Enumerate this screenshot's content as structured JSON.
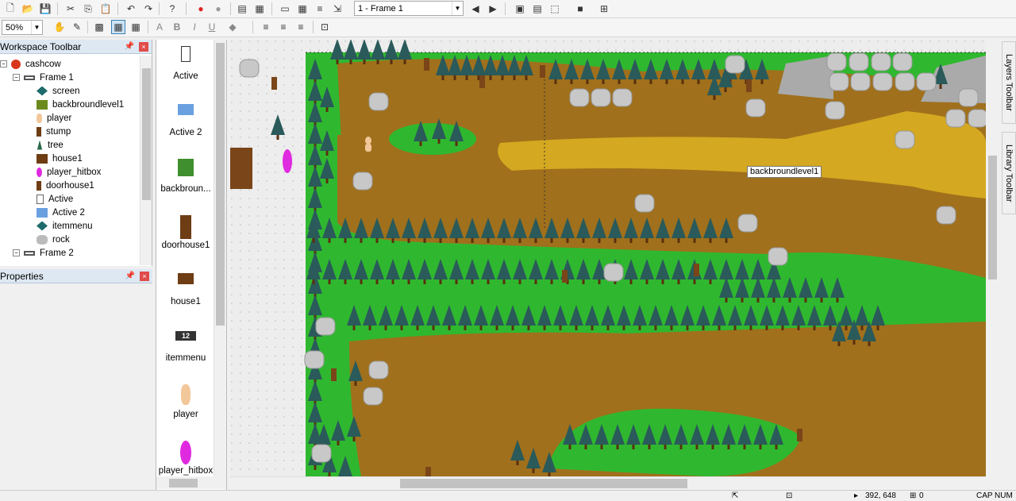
{
  "toolbar": {
    "frame_select": "1 - Frame 1",
    "zoom": "50%",
    "bold": "B",
    "italic": "I",
    "underline": "U"
  },
  "workspace": {
    "title": "Workspace Toolbar",
    "items": [
      {
        "label": "cashcow",
        "icon": "app-icon"
      },
      {
        "label": "Frame 1",
        "icon": "frame-icon"
      },
      {
        "label": "screen",
        "icon": "diamond-icon"
      },
      {
        "label": "backbroundlevel1",
        "icon": "backdrop-icon"
      },
      {
        "label": "player",
        "icon": "player-icon"
      },
      {
        "label": "stump",
        "icon": "stump-icon"
      },
      {
        "label": "tree",
        "icon": "tree-icon"
      },
      {
        "label": "house1",
        "icon": "house-icon"
      },
      {
        "label": "player_hitbox",
        "icon": "hitbox-icon"
      },
      {
        "label": "doorhouse1",
        "icon": "door-icon"
      },
      {
        "label": "Active",
        "icon": "active-icon"
      },
      {
        "label": "Active 2",
        "icon": "active2-icon"
      },
      {
        "label": "itemmenu",
        "icon": "diamond-icon"
      },
      {
        "label": "rock",
        "icon": "rock-icon"
      },
      {
        "label": "Frame 2",
        "icon": "frame-icon"
      }
    ]
  },
  "properties": {
    "title": "Properties"
  },
  "library": {
    "items": [
      {
        "label": "Active"
      },
      {
        "label": "Active 2"
      },
      {
        "label": "backbroun..."
      },
      {
        "label": "doorhouse1"
      },
      {
        "label": "house1"
      },
      {
        "label": "itemmenu"
      },
      {
        "label": "player"
      },
      {
        "label": "player_hitbox"
      }
    ],
    "itemmenu_icon_text": "12"
  },
  "canvas": {
    "tooltip": "backbroundlevel1"
  },
  "side_tabs": {
    "layers": "Layers Toolbar",
    "library": "Library Toolbar"
  },
  "status": {
    "coords": "392, 648",
    "count": "0",
    "caps": "CAP",
    "num": "NUM"
  },
  "colors": {
    "grass": "#2fb82f",
    "dirt": "#a0701c",
    "path": "#d4a820",
    "tree": "#2a5a5a",
    "rock": "#c8c8c8"
  }
}
